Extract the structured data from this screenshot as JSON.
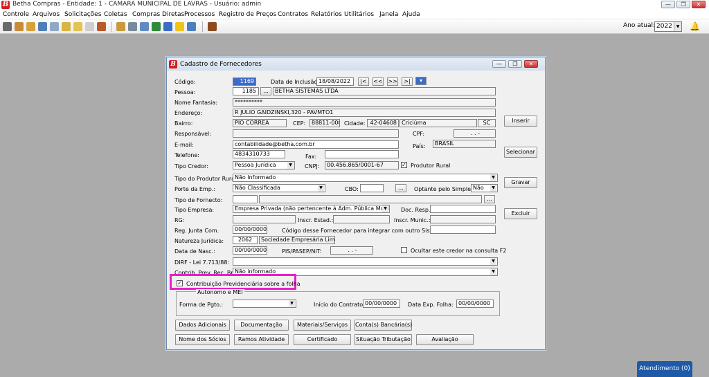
{
  "app": {
    "logo": "B",
    "title": "Betha Compras - Entidade: 1 - CAMARA MUNICIPAL DE LAVRAS - Usuário: admin",
    "win_minimize": "—",
    "win_restore": "❐",
    "win_close": "✕"
  },
  "menu": {
    "items": [
      "Controle",
      "Arquivos",
      "Solicitações",
      "Coletas",
      "Compras Diretas",
      "Processos",
      "Registro de Preços",
      "Contratos",
      "Relatórios",
      "Utilitários",
      "Janela",
      "Ajuda"
    ]
  },
  "toolbar": {
    "ano_label": "Ano atual:",
    "ano_value": "2022",
    "bell_icon": "notification-bell-icon"
  },
  "dialog": {
    "logo": "B",
    "title": "Cadastro de Fornecedores",
    "labels": {
      "codigo": "Código:",
      "data_inclusao": "Data de Inclusão:",
      "pessoa": "Pessoa:",
      "nome_fantasia": "Nome Fantasia:",
      "endereco": "Endereço:",
      "bairro": "Bairro:",
      "cep": "CEP:",
      "cidade": "Cidade:",
      "responsavel": "Responsável:",
      "cpf": "CPF:",
      "email": "E-mail:",
      "pais": "País:",
      "telefone": "Telefone:",
      "fax": "Fax:",
      "tipo_credor": "Tipo Credor:",
      "cnpj": "CNPJ:",
      "produtor_rural": "Produtor Rural",
      "tipo_produtor_rural": "Tipo do Produtor Rural:",
      "porte_emp": "Porte da Emp.:",
      "cbo": "CBO:",
      "optante_simples": "Optante pelo Simples:",
      "tipo_fornecto": "Tipo de Fornecto:",
      "tipo_empresa": "Tipo Empresa:",
      "doc_resp": "Doc. Resp.",
      "rg": "RG:",
      "inscr_estad": "Inscr. Estad.:",
      "inscr_munic": "Inscr. Munic.:",
      "reg_junta": "Reg. Junta Com.",
      "codigo_outro_sistema": "Código desse Fornecedor para integrar com outro Sistema:",
      "natureza_juridica": "Natureza Jurídica:",
      "data_nasc": "Data de Nasc.:",
      "pis_pasep": "PIS/PASEP/NIT:",
      "ocultar_credor": "Ocultar este credor na consulta F2",
      "dirf": "DIRF - Lei 7.713/88:",
      "contrib_prev": "Contrib. Prev. Rec. Bruta:",
      "contrib_folha": "Contribuição Previdenciária sobre a folha",
      "autonomo_mei": "Autonomo e MEI",
      "forma_pgto": "Forma de Pgto.:",
      "inicio_contrato": "Início do Contrato:",
      "data_exp_folha": "Data Exp. Folha:"
    },
    "values": {
      "codigo": "1169",
      "data_inclusao": "18/08/2022",
      "pessoa_codigo": "1185",
      "pessoa_nome": "BETHA SISTEMAS LTDA",
      "nome_fantasia": "**********",
      "endereco": "R JULIO GAIDZINSKI,320 - PAVMTO1",
      "bairro": "PIO CORREA",
      "cep": "88811-000",
      "cidade_codigo": "42-04608",
      "cidade_nome": "Criciúma",
      "uf": "SC",
      "responsavel": "",
      "cpf": ". . -",
      "email": "contabilidade@betha.com.br",
      "pais": "BRASIL",
      "telefone": "4834310733",
      "fax": "",
      "tipo_credor": "Pessoa Jurídica",
      "cnpj": "00.456.865/0001-67",
      "tipo_produtor_rural": "Não Informado",
      "porte_emp": "Não Classificada",
      "cbo": "",
      "optante_simples": "Não",
      "tipo_fornecto": "",
      "tipo_empresa": "Empresa Privada (não pertencente à Adm. Pública Municip",
      "doc_resp": "",
      "rg": "",
      "inscr_estad": "",
      "inscr_munic": "",
      "reg_junta": "00/00/0000",
      "codigo_outro_sistema": "",
      "natureza_codigo": "2062",
      "natureza_nome": "Sociedade Empresária Limitada",
      "data_nasc": "00/00/0000",
      "pis_pasep": ". . -",
      "dirf": "",
      "contrib_prev": "Não informado",
      "forma_pgto": "",
      "inicio_contrato": "00/00/0000",
      "data_exp_folha": "00/00/0000"
    },
    "checks": {
      "produtor_rural": "✓",
      "contrib_folha": "✓",
      "ocultar_credor": ""
    },
    "nav": {
      "first": "|<",
      "prev": "<<",
      "next": ">>",
      "last": ">|"
    },
    "ellipsis": "...",
    "side_buttons": [
      "Inserir",
      "Selecionar",
      "Gravar",
      "Excluir"
    ],
    "bottom_buttons_row1": [
      "Dados Adicionais",
      "Documentação",
      "Materiais/Serviços",
      "Conta(s) Bancária(s)"
    ],
    "bottom_buttons_row2": [
      "Nome dos Sócios",
      "Ramos Atividade",
      "Certificado",
      "Situação Tributação",
      "Avaliação"
    ]
  },
  "atendimento": "Atendimento (0)",
  "colors": {
    "desktop": "#ababab",
    "highlight": "#e620c9",
    "accent_blue": "#1e5aa8",
    "betha_red": "#d41f1f"
  }
}
